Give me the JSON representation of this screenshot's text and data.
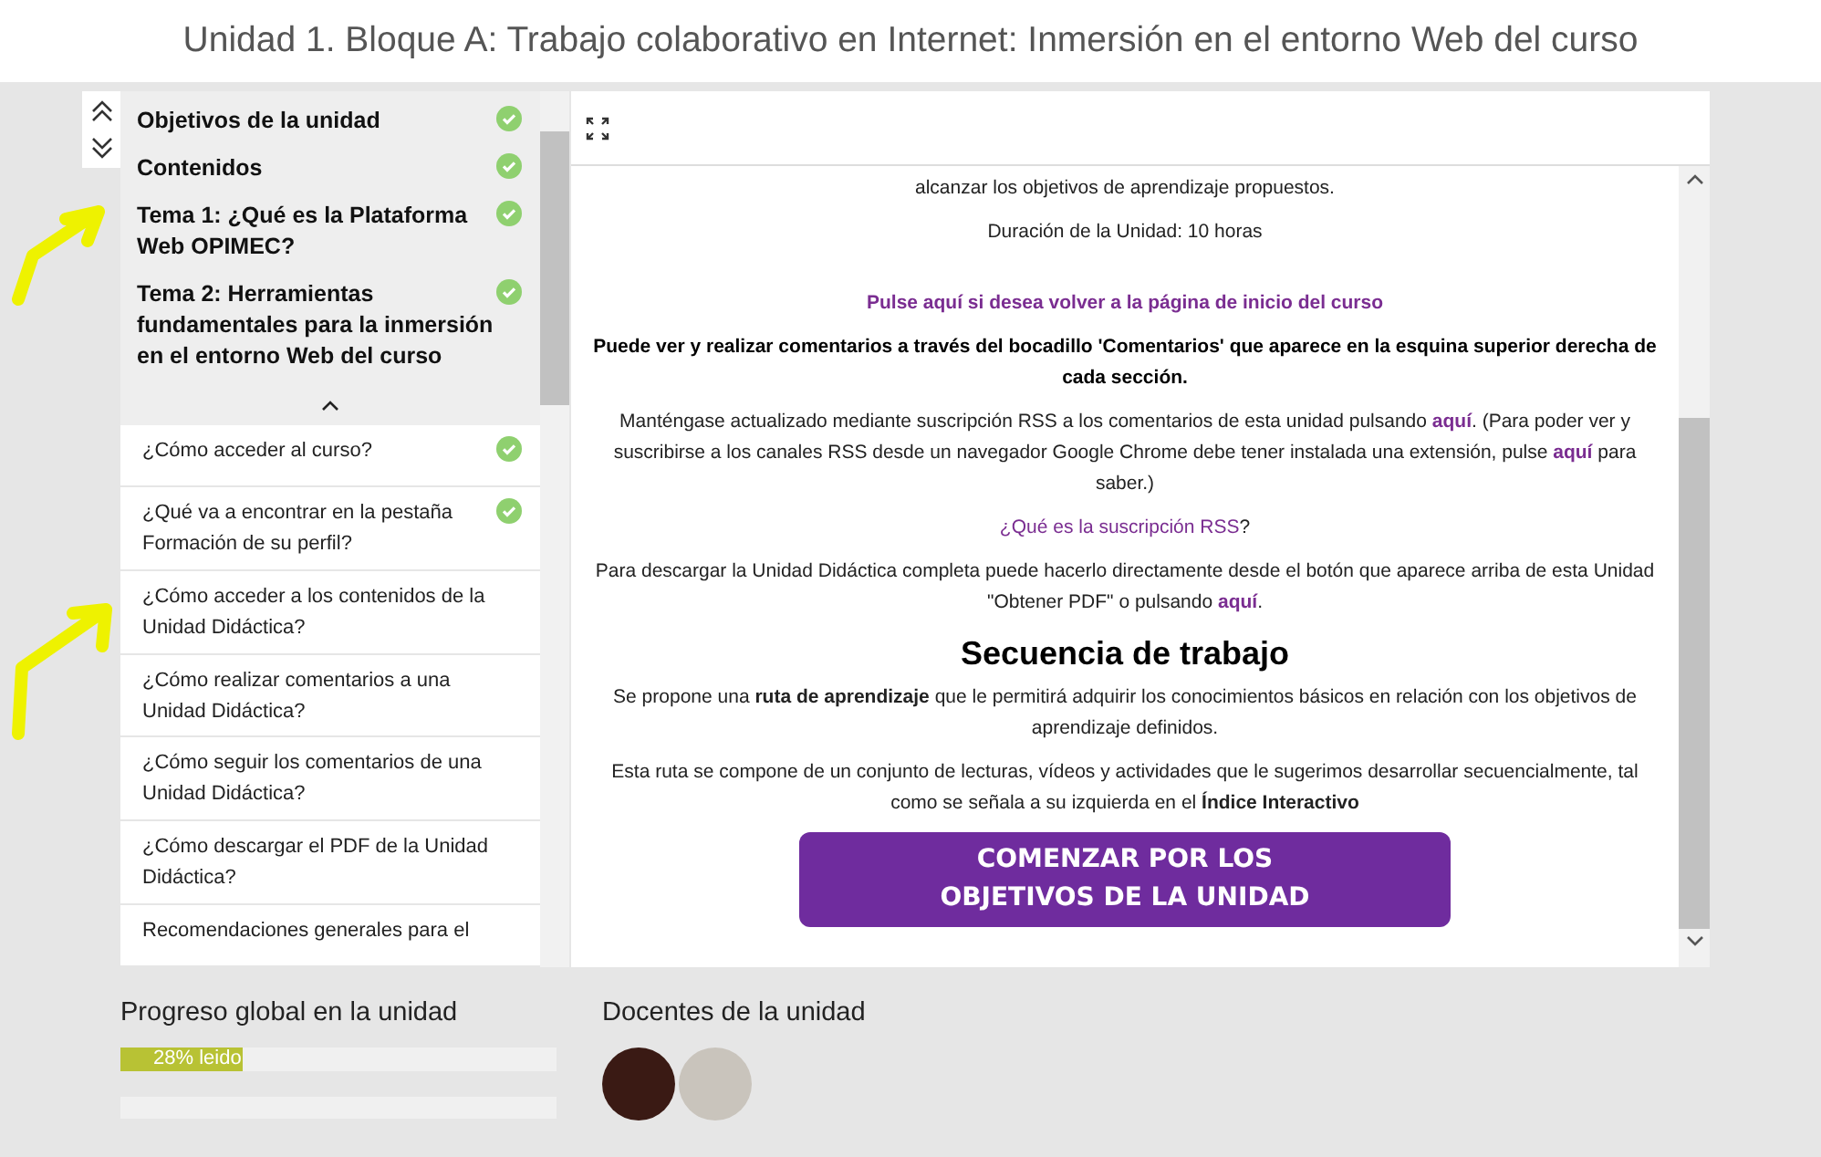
{
  "page_title": "Unidad 1. Bloque A: Trabajo colaborativo en Internet: Inmersión en el entorno Web del curso",
  "sidebar": {
    "sections": [
      {
        "label": "Objetivos de la unidad",
        "done": true
      },
      {
        "label": "Contenidos",
        "done": true
      },
      {
        "label": "Tema 1: ¿Qué es la Plataforma Web OPIMEC?",
        "done": true
      },
      {
        "label": "Tema 2: Herramientas fundamentales para la inmersión en el entorno Web del curso",
        "done": true
      }
    ],
    "items": [
      {
        "label": "¿Cómo acceder al curso?",
        "done": true
      },
      {
        "label": "¿Qué va a encontrar en la pestaña Formación de su perfil?",
        "done": true
      },
      {
        "label": "¿Cómo acceder a los contenidos de la Unidad Didáctica?",
        "done": false
      },
      {
        "label": "¿Cómo realizar comentarios a una Unidad Didáctica?",
        "done": false
      },
      {
        "label": "¿Cómo seguir los comentarios de una Unidad Didáctica?",
        "done": false
      },
      {
        "label": "¿Cómo descargar el PDF de la Unidad Didáctica?",
        "done": false
      },
      {
        "label": "Recomendaciones generales para el",
        "done": false
      }
    ]
  },
  "content": {
    "paragraphs": [
      {
        "kind": "text",
        "segments": [
          {
            "kind": "text",
            "text": "alcanzar los objetivos de aprendizaje propuestos."
          }
        ]
      },
      {
        "kind": "text",
        "segments": [
          {
            "kind": "text",
            "text": "Duración de la Unidad: 10 horas"
          }
        ]
      },
      {
        "kind": "spaced",
        "segments": [
          {
            "kind": "strong_link",
            "text": "Pulse aquí si desea volver a la página de inicio del curso"
          }
        ]
      },
      {
        "kind": "bold",
        "segments": [
          {
            "kind": "text",
            "text": "Puede ver y realizar comentarios a través del bocadillo 'Comentarios' que aparece en la esquina superior derecha de cada sección."
          }
        ]
      },
      {
        "kind": "text",
        "segments": [
          {
            "kind": "text",
            "text": "Manténgase actualizado mediante suscripción RSS a los comentarios de esta unidad pulsando "
          },
          {
            "kind": "strong_link",
            "text": "aquí"
          },
          {
            "kind": "text",
            "text": ". (Para poder ver y suscribirse a los canales RSS desde un navegador Google Chrome debe tener instalada una extensión, pulse "
          },
          {
            "kind": "strong_link",
            "text": "aquí"
          },
          {
            "kind": "text",
            "text": " para saber.)"
          }
        ]
      },
      {
        "kind": "text",
        "segments": [
          {
            "kind": "link",
            "text": "¿Qué es la suscripción RSS"
          },
          {
            "kind": "text",
            "text": "?"
          }
        ]
      },
      {
        "kind": "text",
        "segments": [
          {
            "kind": "text",
            "text": "Para descargar la Unidad Didáctica completa puede hacerlo directamente desde el botón que aparece arriba de esta Unidad \"Obtener PDF\" o pulsando "
          },
          {
            "kind": "strong_link",
            "text": "aquí"
          },
          {
            "kind": "text",
            "text": "."
          }
        ]
      },
      {
        "kind": "heading",
        "segments": [
          {
            "kind": "text",
            "text": "Secuencia de trabajo"
          }
        ]
      },
      {
        "kind": "text",
        "segments": [
          {
            "kind": "text",
            "text": "Se propone una **ruta de aprendizaje** que le permitirá adquirir los conocimientos básicos en relación con los objetivos de aprendizaje definidos."
          }
        ]
      },
      {
        "kind": "text",
        "segments": [
          {
            "kind": "text",
            "text": "Esta ruta se compone de un conjunto de lecturas, vídeos y actividades que le sugerimos desarrollar secuencialmente, tal como se señala a su izquierda en el **Índice Interactivo**"
          }
        ]
      }
    ],
    "button_lines": [
      "COMENZAR POR LOS",
      "OBJETIVOS DE LA UNIDAD"
    ]
  },
  "progress": {
    "title": "Progreso global en la unidad",
    "label": "28% leido",
    "level": 0.28
  },
  "teachers": {
    "title": "Docentes de la unidad",
    "avatars": [
      {
        "kind": "dark"
      },
      {
        "kind": "light"
      }
    ]
  }
}
